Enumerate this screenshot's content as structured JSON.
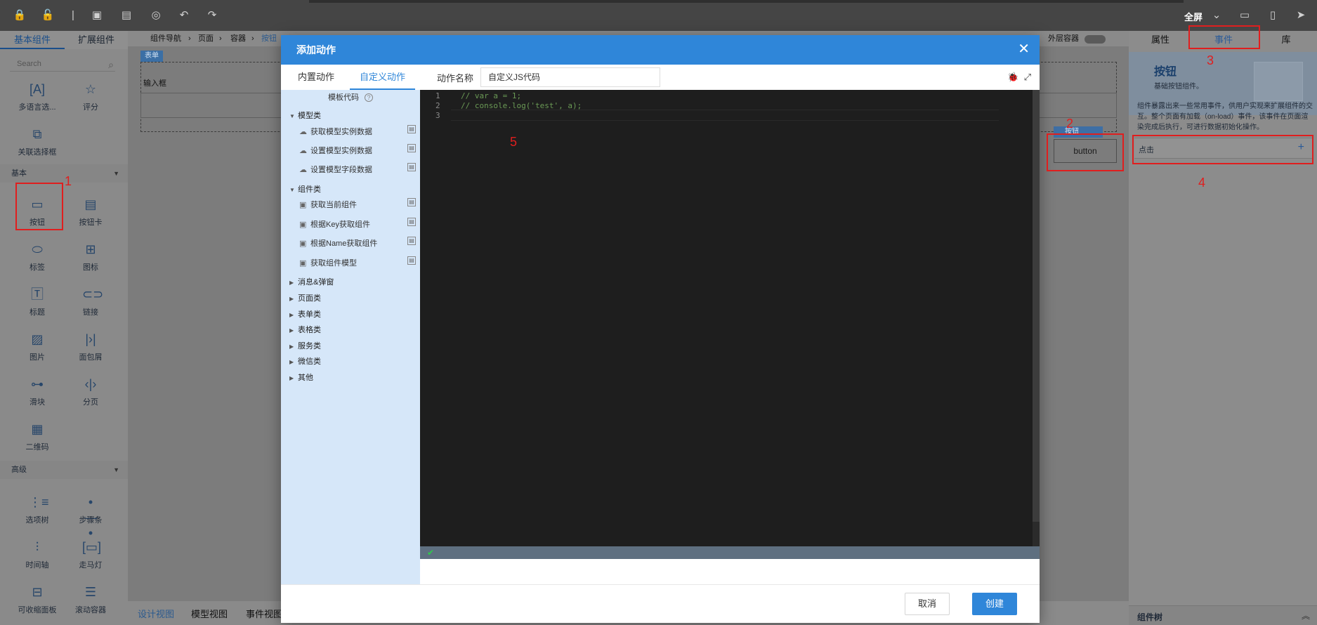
{
  "toolbar": {
    "fullscreen_label": "全屏",
    "icons": [
      "lock-icon",
      "unlock-icon",
      "cursor-icon",
      "save-icon",
      "save-as-icon",
      "preview-icon",
      "undo-icon",
      "redo-icon"
    ],
    "right_icons": [
      "chevron-down-icon",
      "desktop-icon",
      "mobile-icon",
      "send-icon"
    ]
  },
  "left_panel": {
    "tabs": [
      "基本组件",
      "扩展组件"
    ],
    "active_tab": "基本组件",
    "search_placeholder": "Search",
    "top_components": [
      {
        "label": "多语言选...",
        "icon": "translate-icon"
      },
      {
        "label": "评分",
        "icon": "star-rating-icon"
      },
      {
        "label": "关联选择框",
        "icon": "link-select-icon"
      }
    ],
    "section_basic": "基本",
    "basic_components": [
      {
        "label": "按钮",
        "icon": "button-icon"
      },
      {
        "label": "按钮卡",
        "icon": "button-card-icon"
      },
      {
        "label": "标签",
        "icon": "tag-icon"
      },
      {
        "label": "图标",
        "icon": "grid-icon"
      },
      {
        "label": "标题",
        "icon": "title-icon"
      },
      {
        "label": "链接",
        "icon": "link-icon"
      },
      {
        "label": "图片",
        "icon": "image-icon"
      },
      {
        "label": "面包屑",
        "icon": "breadcrumb-icon"
      },
      {
        "label": "滑块",
        "icon": "slider-icon"
      },
      {
        "label": "分页",
        "icon": "pagination-icon"
      },
      {
        "label": "二维码",
        "icon": "qrcode-icon"
      }
    ],
    "section_advanced": "高级",
    "advanced_components": [
      {
        "label": "选项树",
        "icon": "tree-icon"
      },
      {
        "label": "步骤条",
        "icon": "steps-icon"
      },
      {
        "label": "时间轴",
        "icon": "timeline-icon"
      },
      {
        "label": "走马灯",
        "icon": "carousel-icon"
      },
      {
        "label": "可收缩面板",
        "icon": "collapse-icon"
      },
      {
        "label": "滚动容器",
        "icon": "scroll-container-icon"
      }
    ]
  },
  "canvas": {
    "breadcrumb": [
      "组件导航",
      "页面",
      "容器",
      "按钮"
    ],
    "outer_container_label": "外层容器",
    "form_tag": "表单",
    "input_label": "输入框",
    "button_tag": "按钮",
    "button_text": "button"
  },
  "bottom_tabs": [
    "设计视图",
    "模型视图",
    "事件视图"
  ],
  "right_panel": {
    "tabs": [
      "属性",
      "事件",
      "库"
    ],
    "active_tab": "事件",
    "card_title": "按钮",
    "card_subtitle": "基础按钮组件。",
    "description": "组件暴露出来一些常用事件，供用户实现来扩展组件的交互。整个页面有加载（on-load）事件，该事件在页面渲染完成后执行，可进行数据初始化操作。",
    "event_label": "点击",
    "add_symbol": "+",
    "component_tree_label": "组件树"
  },
  "modal": {
    "title": "添加动作",
    "tabs": [
      "内置动作",
      "自定义动作"
    ],
    "active_tab": "自定义动作",
    "template_title": "模板代码",
    "categories": [
      {
        "name": "模型类",
        "expanded": true,
        "items": [
          "获取模型实例数据",
          "设置模型实例数据",
          "设置模型字段数据"
        ]
      },
      {
        "name": "组件类",
        "expanded": true,
        "items": [
          "获取当前组件",
          "根据Key获取组件",
          "根据Name获取组件",
          "获取组件模型"
        ]
      },
      {
        "name": "消息&弹窗",
        "expanded": false,
        "items": []
      },
      {
        "name": "页面类",
        "expanded": false,
        "items": []
      },
      {
        "name": "表单类",
        "expanded": false,
        "items": []
      },
      {
        "name": "表格类",
        "expanded": false,
        "items": []
      },
      {
        "name": "服务类",
        "expanded": false,
        "items": []
      },
      {
        "name": "微信类",
        "expanded": false,
        "items": []
      },
      {
        "name": "其他",
        "expanded": false,
        "items": []
      }
    ],
    "action_name_label": "动作名称",
    "action_name_value": "自定义JS代码",
    "code_lines": [
      {
        "no": "1",
        "text": "// var a = 1;"
      },
      {
        "no": "2",
        "text": "// console.log('test', a);"
      },
      {
        "no": "3",
        "text": ""
      }
    ],
    "status_icon": "check-icon",
    "cancel_label": "取消",
    "create_label": "创建"
  },
  "annotations": [
    "1",
    "2",
    "3",
    "4",
    "5"
  ],
  "colors": {
    "primary": "#2f86d9",
    "annotation": "#e01e1e",
    "editor_bg": "#1e1e1e",
    "code_comment": "#6a9955"
  }
}
